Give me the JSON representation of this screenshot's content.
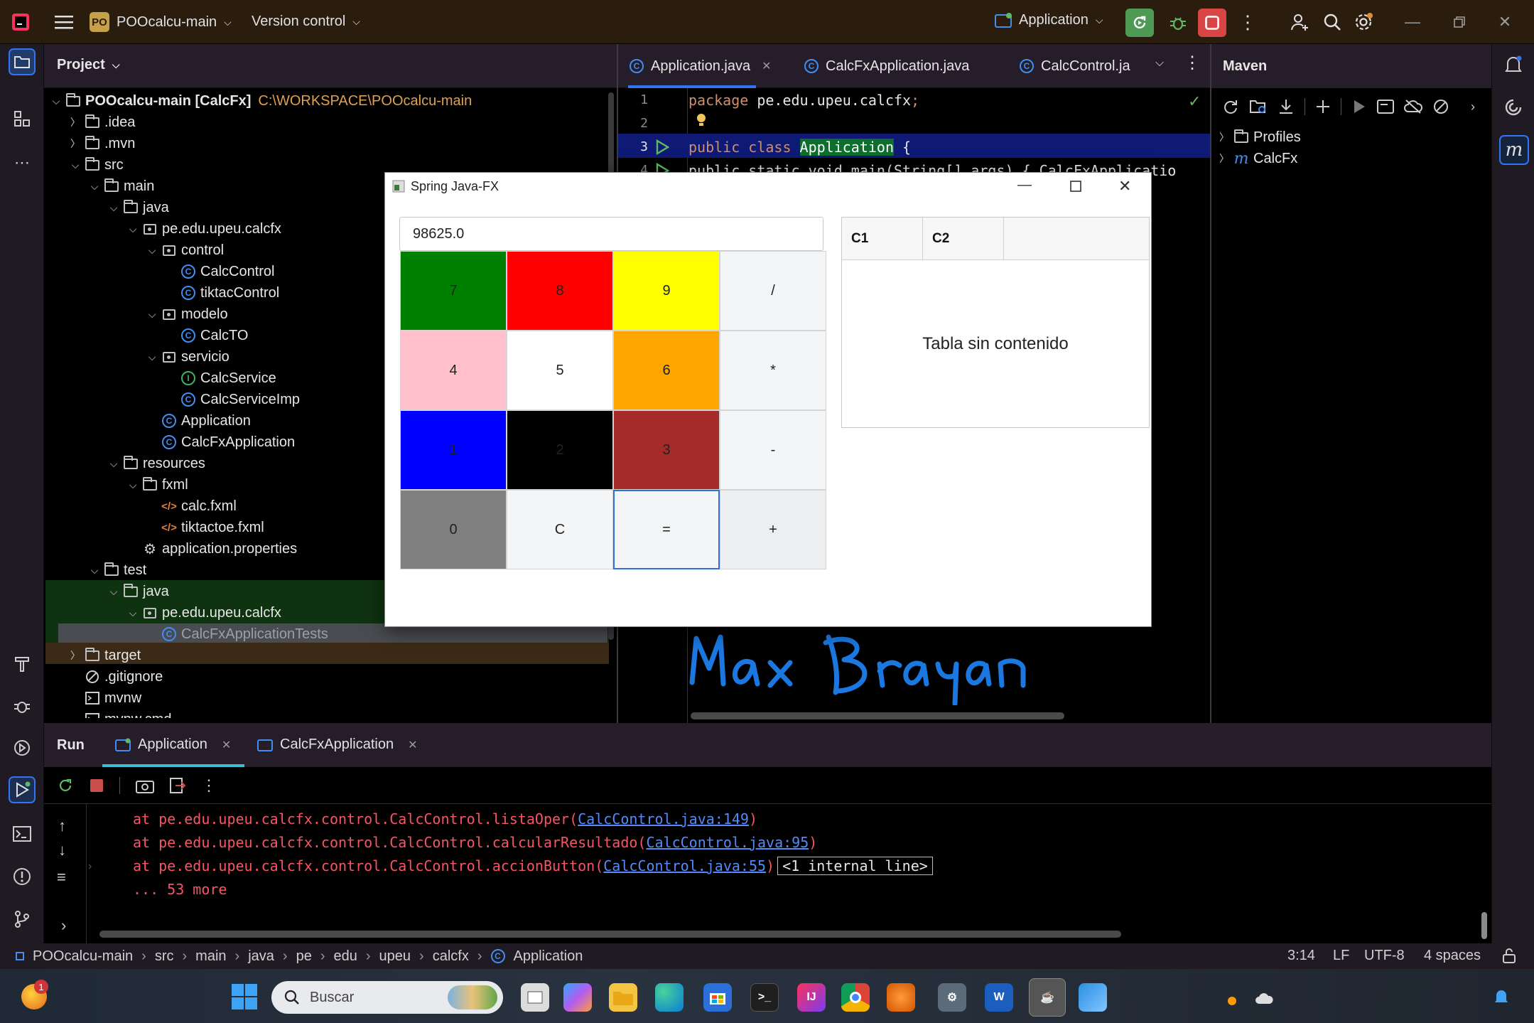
{
  "titlebar": {
    "project_badge": "PO",
    "project_name": "POOcalcu-main",
    "version_control": "Version control",
    "run_config": "Application"
  },
  "project_panel": {
    "title": "Project",
    "root_name": "POOcalcu-main [CalcFx]",
    "root_path": "C:\\WORKSPACE\\POOcalcu-main",
    "items": [
      {
        "label": ".idea",
        "icon": "folder-icon"
      },
      {
        "label": ".mvn",
        "icon": "folder-icon"
      },
      {
        "label": "src",
        "icon": "folder-icon"
      },
      {
        "label": "main",
        "icon": "folder-icon"
      },
      {
        "label": "java",
        "icon": "folder-icon"
      },
      {
        "label": "pe.edu.upeu.calcfx",
        "icon": "package-icon"
      },
      {
        "label": "control",
        "icon": "package-icon"
      },
      {
        "label": "CalcControl",
        "icon": "class-icon"
      },
      {
        "label": "tiktacControl",
        "icon": "class-icon"
      },
      {
        "label": "modelo",
        "icon": "package-icon"
      },
      {
        "label": "CalcTO",
        "icon": "class-icon"
      },
      {
        "label": "servicio",
        "icon": "package-icon"
      },
      {
        "label": "CalcService",
        "icon": "interface-icon"
      },
      {
        "label": "CalcServiceImp",
        "icon": "class-icon"
      },
      {
        "label": "Application",
        "icon": "class-icon"
      },
      {
        "label": "CalcFxApplication",
        "icon": "class-icon"
      },
      {
        "label": "resources",
        "icon": "folder-icon"
      },
      {
        "label": "fxml",
        "icon": "folder-icon"
      },
      {
        "label": "calc.fxml",
        "icon": "xml-icon"
      },
      {
        "label": "tiktactoe.fxml",
        "icon": "xml-icon"
      },
      {
        "label": "application.properties",
        "icon": "settings-icon"
      },
      {
        "label": "test",
        "icon": "folder-icon"
      },
      {
        "label": "java",
        "icon": "folder-icon"
      },
      {
        "label": "pe.edu.upeu.calcfx",
        "icon": "package-icon"
      },
      {
        "label": "CalcFxApplicationTests",
        "icon": "class-icon"
      },
      {
        "label": "target",
        "icon": "folder-icon"
      },
      {
        "label": ".gitignore",
        "icon": "ignore-icon"
      },
      {
        "label": "mvnw",
        "icon": "file-icon"
      },
      {
        "label": "mvnw.cmd",
        "icon": "file-icon"
      }
    ]
  },
  "editor": {
    "tabs": [
      "Application.java",
      "CalcFxApplication.java",
      "CalcControl.ja"
    ],
    "line_numbers": [
      "1",
      "2",
      "3",
      "4"
    ],
    "line1_kw": "package",
    "line1_rest": " pe.edu.upeu.calcfx",
    "line1_semi": ";",
    "line3_kw": "public class",
    "line3_cls": "Application",
    "line3_brace": " {",
    "line4_text": "    public static void main(String[] args) { CalcFxApplicatio",
    "signature": "Max Brayan"
  },
  "maven": {
    "title": "Maven",
    "items": [
      "Profiles",
      "CalcFx"
    ]
  },
  "fx_window": {
    "title": "Spring Java-FX",
    "display_value": "98625.0",
    "keys": [
      {
        "label": "7",
        "color": "#008000"
      },
      {
        "label": "8",
        "color": "#ff0000"
      },
      {
        "label": "9",
        "color": "#ffff00"
      },
      {
        "label": "/",
        "color": "#f4f5f6"
      },
      {
        "label": "4",
        "color": "#ffc0cb"
      },
      {
        "label": "5",
        "color": "#ffffff"
      },
      {
        "label": "6",
        "color": "#ffa500"
      },
      {
        "label": "*",
        "color": "#f4f5f6"
      },
      {
        "label": "1",
        "color": "#0000ff"
      },
      {
        "label": "2",
        "color": "#000000"
      },
      {
        "label": "3",
        "color": "#a52a2a"
      },
      {
        "label": "-",
        "color": "#f4f5f6"
      },
      {
        "label": "0",
        "color": "#808080"
      },
      {
        "label": "C",
        "color": "#f4f5f6"
      },
      {
        "label": "=",
        "color": "#f4f5f6"
      },
      {
        "label": "+",
        "color": "#eceef0"
      }
    ],
    "table": {
      "columns": [
        "C1",
        "C2"
      ],
      "empty_text": "Tabla sin contenido"
    }
  },
  "run_panel": {
    "title": "Run",
    "tabs": [
      "Application",
      "CalcFxApplication"
    ],
    "console": [
      {
        "prefix": "at pe.edu.upeu.calcfx.control.CalcControl.listaOper(",
        "link": "CalcControl.java:149",
        "suffix": ")"
      },
      {
        "prefix": "at pe.edu.upeu.calcfx.control.CalcControl.calcularResultado(",
        "link": "CalcControl.java:95",
        "suffix": ")"
      },
      {
        "prefix": "at pe.edu.upeu.calcfx.control.CalcControl.accionButton(",
        "link": "CalcControl.java:55",
        "suffix": ")",
        "badge": "<1 internal line>"
      },
      {
        "prefix": "... 53 more",
        "link": "",
        "suffix": ""
      }
    ]
  },
  "statusbar": {
    "breadcrumb": [
      "POOcalcu-main",
      "src",
      "main",
      "java",
      "pe",
      "edu",
      "upeu",
      "calcfx",
      "Application"
    ],
    "position": "3:14",
    "line_sep": "LF",
    "encoding": "UTF-8",
    "indent": "4 spaces"
  },
  "taskbar": {
    "search_placeholder": "Buscar",
    "notification_count": "1"
  },
  "colors": {
    "accent": "#3574f0",
    "error_text": "#f75464",
    "link": "#548af7",
    "run_green": "#5fb865",
    "stop_red": "#db5c5c"
  }
}
